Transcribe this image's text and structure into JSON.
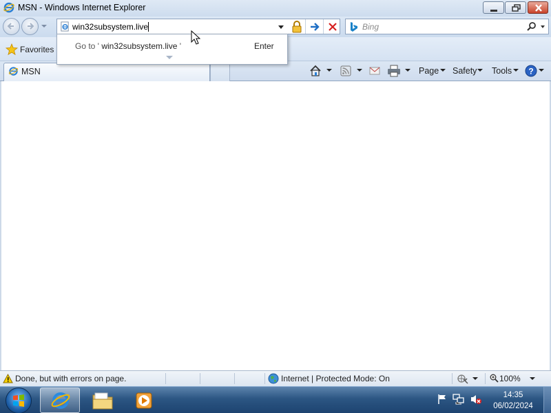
{
  "window": {
    "title": "MSN - Windows Internet Explorer",
    "controls": [
      "minimize",
      "maximize",
      "close"
    ]
  },
  "navigation": {
    "address_value": "win32subsystem.live",
    "search_placeholder": "Bing",
    "icons": [
      "back-icon",
      "forward-icon",
      "page-icon",
      "lock-icon",
      "go-icon",
      "stop-icon",
      "bing-icon",
      "search-icon"
    ]
  },
  "autocomplete": {
    "prefix": "Go to '",
    "url": "win32subsystem.live",
    "suffix": "'",
    "hint": "Enter"
  },
  "favorites": {
    "label": "Favorites"
  },
  "tabs": [
    {
      "label": "MSN"
    }
  ],
  "commandbar": {
    "page_label": "Page",
    "safety_label": "Safety",
    "tools_label": "Tools",
    "icons": [
      "home-icon",
      "feeds-icon",
      "mail-icon",
      "print-icon",
      "help-icon"
    ]
  },
  "statusbar": {
    "message": "Done, but with errors on page.",
    "zone": "Internet | Protected Mode: On",
    "zoom": "100%"
  },
  "taskbar": {
    "time": "14:35",
    "date": "06/02/2024",
    "apps": [
      "internet-explorer",
      "windows-explorer",
      "media-player"
    ]
  },
  "colors": {
    "chrome_blue": "#cddcee",
    "stop_red": "#d62020",
    "go_blue": "#1f6fc5",
    "taskbar": "#2c5683"
  }
}
